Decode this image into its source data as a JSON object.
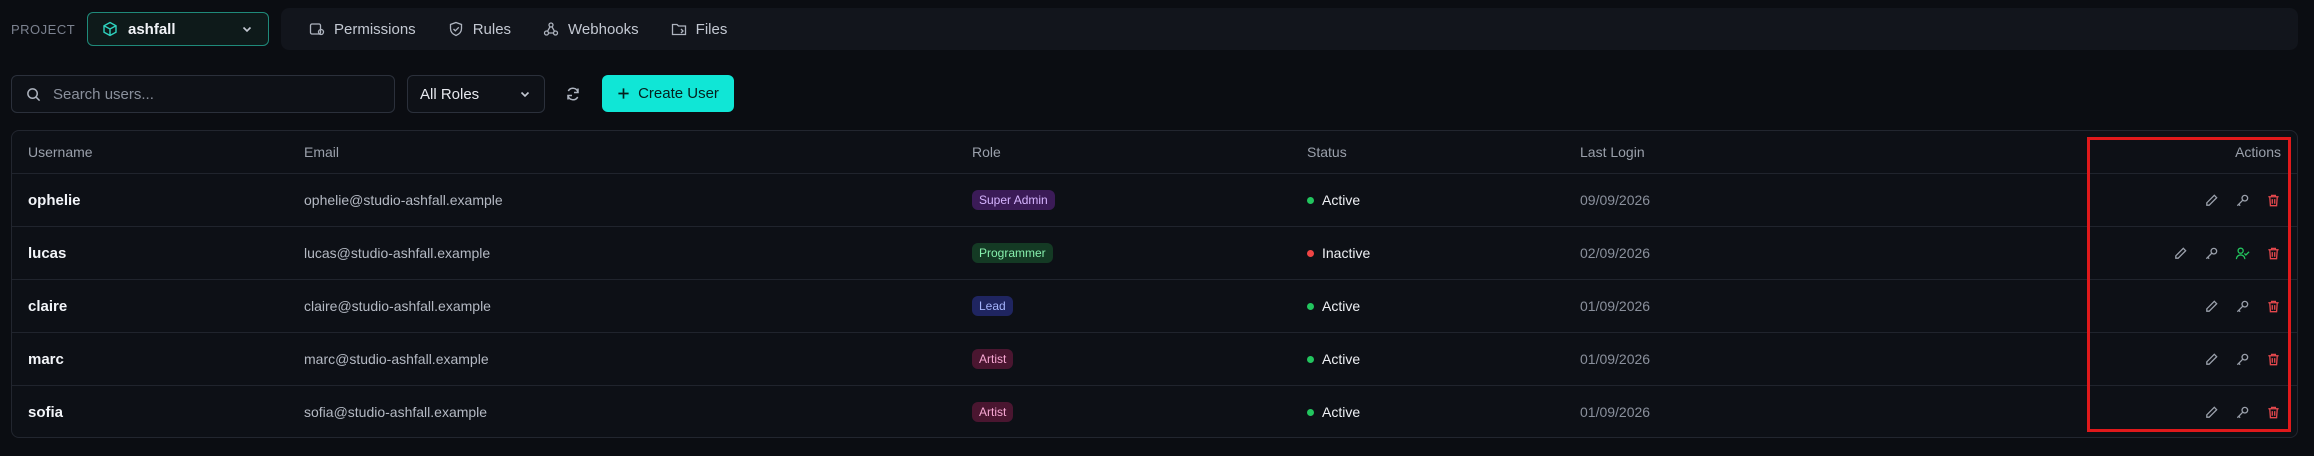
{
  "header": {
    "project_label": "PROJECT",
    "project_name": "ashfall",
    "nav": [
      {
        "label": "Permissions",
        "icon": "permissions-icon"
      },
      {
        "label": "Rules",
        "icon": "shield-icon"
      },
      {
        "label": "Webhooks",
        "icon": "webhook-icon"
      },
      {
        "label": "Files",
        "icon": "folder-icon"
      }
    ]
  },
  "toolbar": {
    "search_placeholder": "Search users...",
    "role_filter": "All Roles",
    "create_label": "Create User"
  },
  "table": {
    "columns": [
      "Username",
      "Email",
      "Role",
      "Status",
      "Last Login",
      "Actions"
    ],
    "rows": [
      {
        "username": "ophelie",
        "email": "ophelie@studio-ashfall.example",
        "role": "Super Admin",
        "status": "Active",
        "last_login": "09/09/2026"
      },
      {
        "username": "lucas",
        "email": "lucas@studio-ashfall.example",
        "role": "Programmer",
        "status": "Inactive",
        "last_login": "02/09/2026"
      },
      {
        "username": "claire",
        "email": "claire@studio-ashfall.example",
        "role": "Lead",
        "status": "Active",
        "last_login": "01/09/2026"
      },
      {
        "username": "marc",
        "email": "marc@studio-ashfall.example",
        "role": "Artist",
        "status": "Active",
        "last_login": "01/09/2026"
      },
      {
        "username": "sofia",
        "email": "sofia@studio-ashfall.example",
        "role": "Artist",
        "status": "Active",
        "last_login": "01/09/2026"
      }
    ]
  },
  "colors": {
    "accent": "#10e6d6",
    "active": "#22c55e",
    "inactive": "#ef4444",
    "delete": "#e5484d",
    "highlight": "#e0191b"
  }
}
